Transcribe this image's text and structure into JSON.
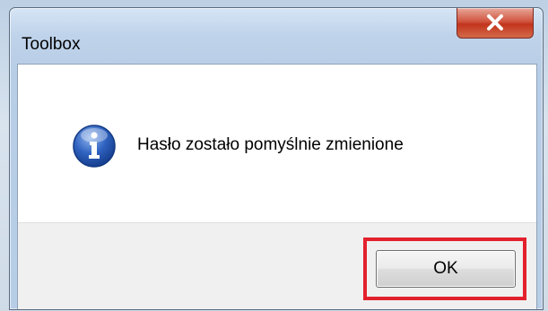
{
  "window": {
    "title": "Toolbox",
    "close_icon": "close-icon"
  },
  "dialog": {
    "icon": "info-icon",
    "message": "Hasło zostało pomyślnie zmienione",
    "ok_label": "OK"
  },
  "colors": {
    "highlight": "#e3212d",
    "close_button": "#c2341c",
    "info_icon": "#1f4fa6"
  }
}
